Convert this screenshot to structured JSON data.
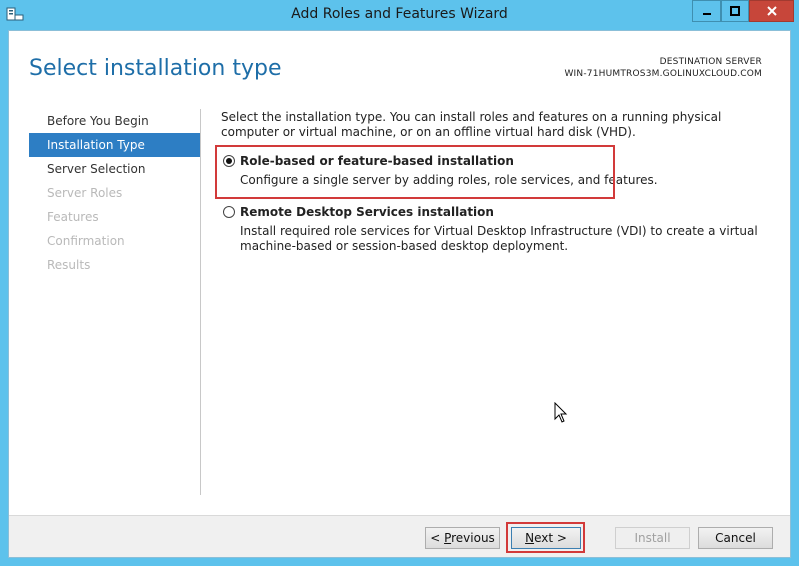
{
  "window": {
    "title": "Add Roles and Features Wizard",
    "icons": {
      "app": "server-manager-icon",
      "minimize": "minimize-icon",
      "maximize": "maximize-icon",
      "close": "close-icon"
    }
  },
  "header": {
    "page_title": "Select installation type",
    "destination_label": "DESTINATION SERVER",
    "destination_server": "WIN-71HUMTROS3M.GOLINUXCLOUD.COM"
  },
  "nav": {
    "items": [
      {
        "label": "Before You Begin",
        "state": "normal"
      },
      {
        "label": "Installation Type",
        "state": "active"
      },
      {
        "label": "Server Selection",
        "state": "normal"
      },
      {
        "label": "Server Roles",
        "state": "disabled"
      },
      {
        "label": "Features",
        "state": "disabled"
      },
      {
        "label": "Confirmation",
        "state": "disabled"
      },
      {
        "label": "Results",
        "state": "disabled"
      }
    ]
  },
  "content": {
    "intro": "Select the installation type. You can install roles and features on a running physical computer or virtual machine, or on an offline virtual hard disk (VHD).",
    "options": [
      {
        "title": "Role-based or feature-based installation",
        "description": "Configure a single server by adding roles, role services, and features.",
        "selected": true
      },
      {
        "title": "Remote Desktop Services installation",
        "description": "Install required role services for Virtual Desktop Infrastructure (VDI) to create a virtual machine-based or session-based desktop deployment.",
        "selected": false
      }
    ]
  },
  "footer": {
    "previous_prefix": "< ",
    "previous_key": "P",
    "previous_rest": "revious",
    "next_key": "N",
    "next_rest": "ext >",
    "install": "Install",
    "cancel": "Cancel"
  },
  "colors": {
    "chrome": "#5dc2ec",
    "accent": "#2d7ec4",
    "title_text": "#1e6ea8",
    "highlight": "#d23a3a",
    "close_button": "#c7463a"
  }
}
